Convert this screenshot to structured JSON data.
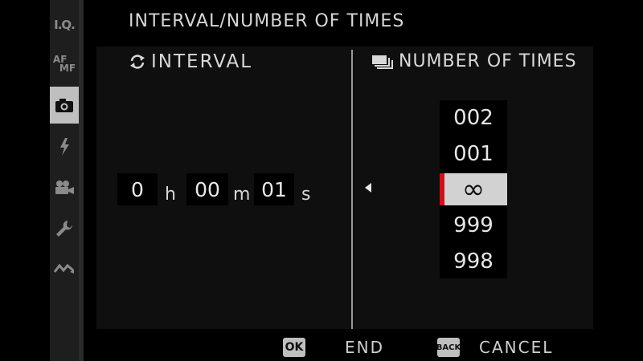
{
  "title": "INTERVAL/NUMBER OF TIMES",
  "rail": {
    "items": [
      {
        "label": "I.Q.",
        "icon": "image-quality-icon"
      },
      {
        "label_top": "AF",
        "label_bottom": "MF",
        "icon": "af-mf-icon"
      },
      {
        "icon": "camera-icon",
        "active": true
      },
      {
        "icon": "flash-icon"
      },
      {
        "icon": "movie-icon"
      },
      {
        "icon": "wrench-icon"
      },
      {
        "icon": "connection-icon"
      }
    ]
  },
  "interval": {
    "label": "INTERVAL",
    "icon": "repeat-icon",
    "hours": "0",
    "hours_unit": "h",
    "minutes": "00",
    "minutes_unit": "m",
    "seconds": "01",
    "seconds_unit": "s"
  },
  "number_of_times": {
    "label": "NUMBER OF TIMES",
    "icon": "stacked-frames-icon",
    "options": [
      "002",
      "001",
      "∞",
      "999",
      "998"
    ],
    "selected_index": 2
  },
  "footer": {
    "ok_key": "OK",
    "ok_label": "END",
    "back_key": "BACK",
    "back_label": "CANCEL"
  },
  "colors": {
    "selection_marker": "#c8141c",
    "selected_bg": "#d2d2d2",
    "active_rail_bg": "#bfbfbf"
  }
}
